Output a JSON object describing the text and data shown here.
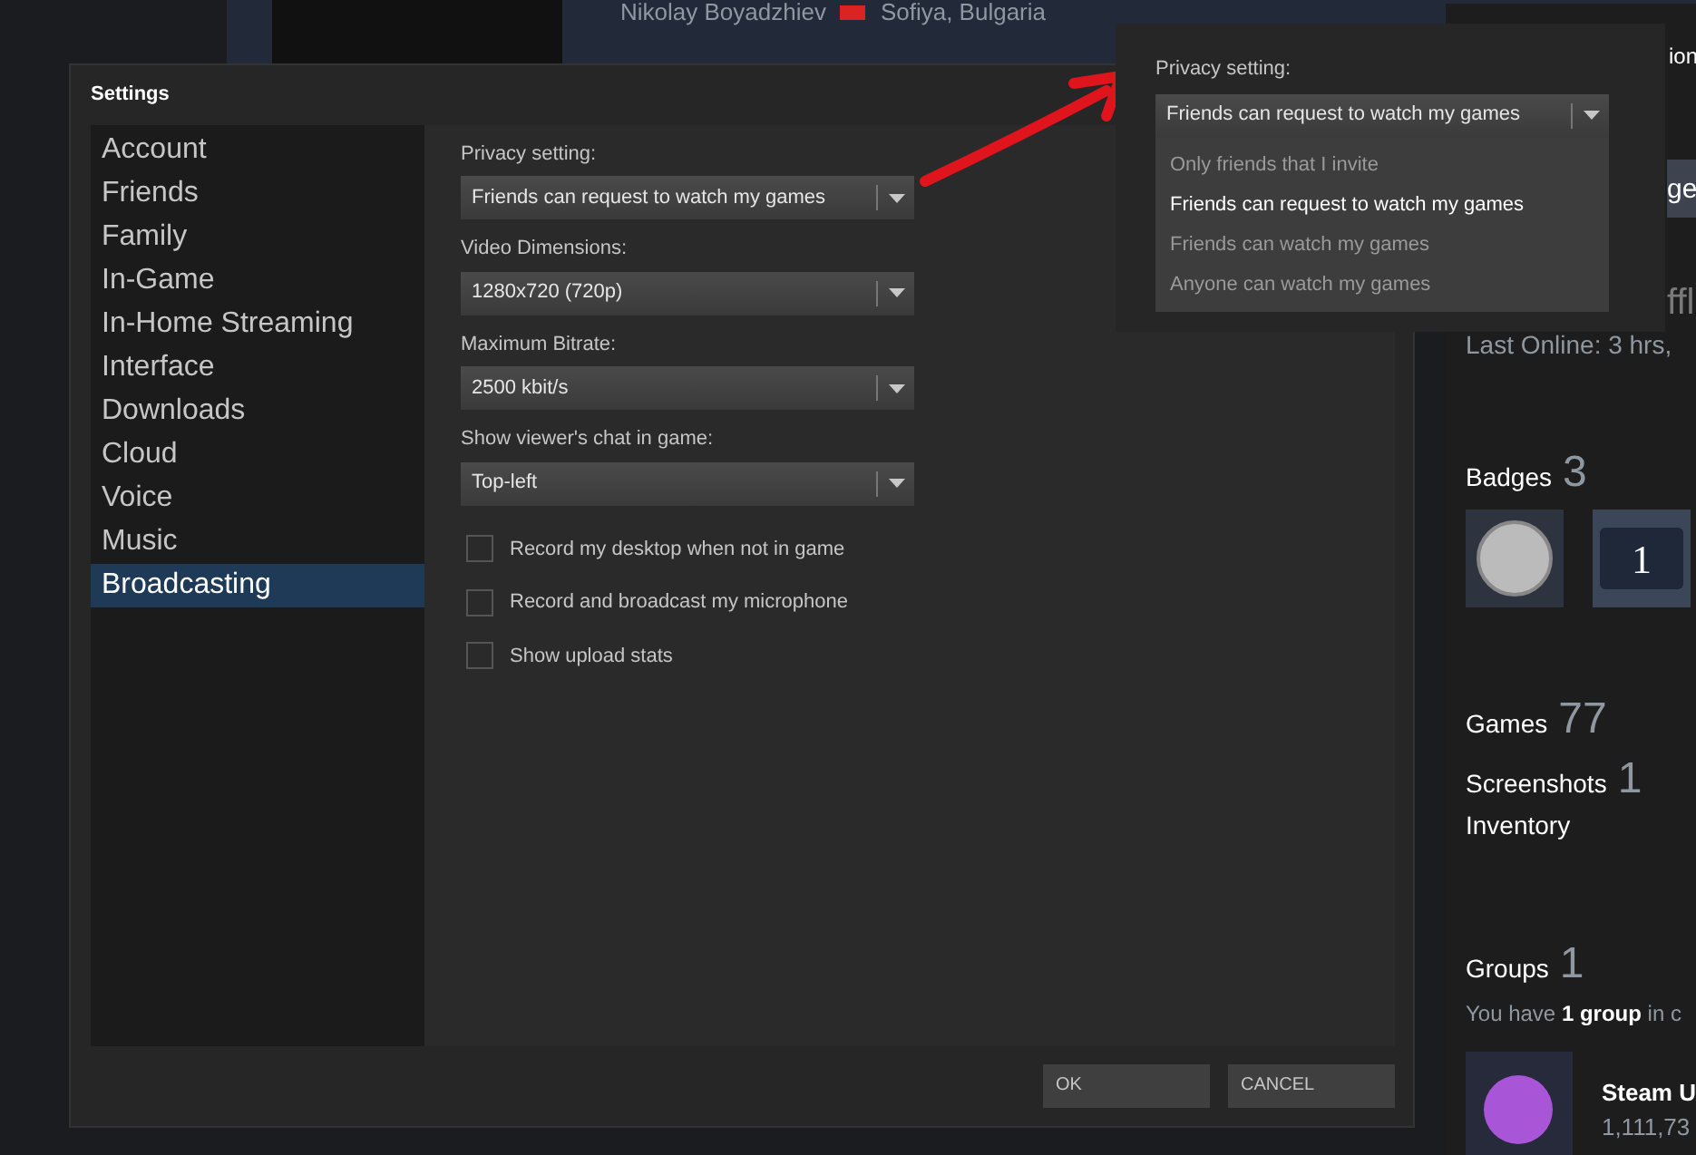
{
  "profile": {
    "name": "Nikolay Boyadzhiev",
    "location": "Sofiya, Bulgaria"
  },
  "right_column": {
    "status_fragment": "ion",
    "button_fragment": "ge",
    "status_fragment_2": "ffl",
    "last_online": "Last Online: 3 hrs,",
    "badges": {
      "label": "Badges",
      "count": "3",
      "items": [
        {
          "kind": "coin"
        },
        {
          "kind": "number",
          "text": "1"
        }
      ]
    },
    "stats": [
      {
        "label": "Games",
        "count": "77"
      },
      {
        "label": "Screenshots",
        "count": "1"
      },
      {
        "label": "Inventory"
      }
    ],
    "groups": {
      "label": "Groups",
      "count": "1",
      "summary": "You have **1 group** in c",
      "group": {
        "name": "Steam U",
        "members": "1,111,73"
      }
    }
  },
  "settings": {
    "title": "Settings",
    "nav": [
      {
        "label": "Account",
        "selected": false
      },
      {
        "label": "Friends",
        "selected": false
      },
      {
        "label": "Family",
        "selected": false
      },
      {
        "label": "In-Game",
        "selected": false
      },
      {
        "label": "In-Home Streaming",
        "selected": false
      },
      {
        "label": "Interface",
        "selected": false
      },
      {
        "label": "Downloads",
        "selected": false
      },
      {
        "label": "Cloud",
        "selected": false
      },
      {
        "label": "Voice",
        "selected": false
      },
      {
        "label": "Music",
        "selected": false
      },
      {
        "label": "Broadcasting",
        "selected": true
      }
    ],
    "fields": [
      {
        "label": "Privacy setting:",
        "value": "Friends can request to watch my games"
      },
      {
        "label": "Video Dimensions:",
        "value": "1280x720 (720p)"
      },
      {
        "label": "Maximum Bitrate:",
        "value": "2500 kbit/s"
      },
      {
        "label": "Show viewer's chat in game:",
        "value": "Top-left"
      }
    ],
    "checkboxes": [
      {
        "label": "Record my desktop when not in game",
        "checked": false
      },
      {
        "label": "Record and broadcast my microphone",
        "checked": false
      },
      {
        "label": "Show upload stats",
        "checked": false
      }
    ],
    "buttons": [
      "OK",
      "CANCEL"
    ]
  },
  "inset": {
    "label": "Privacy setting:",
    "value": "Friends can request to watch my games",
    "options": [
      {
        "text": "Only friends that I invite",
        "selected": false
      },
      {
        "text": "Friends can request to watch my games",
        "selected": true
      },
      {
        "text": "Friends can watch my games",
        "selected": false
      },
      {
        "text": "Anyone can watch my games",
        "selected": false
      }
    ]
  }
}
